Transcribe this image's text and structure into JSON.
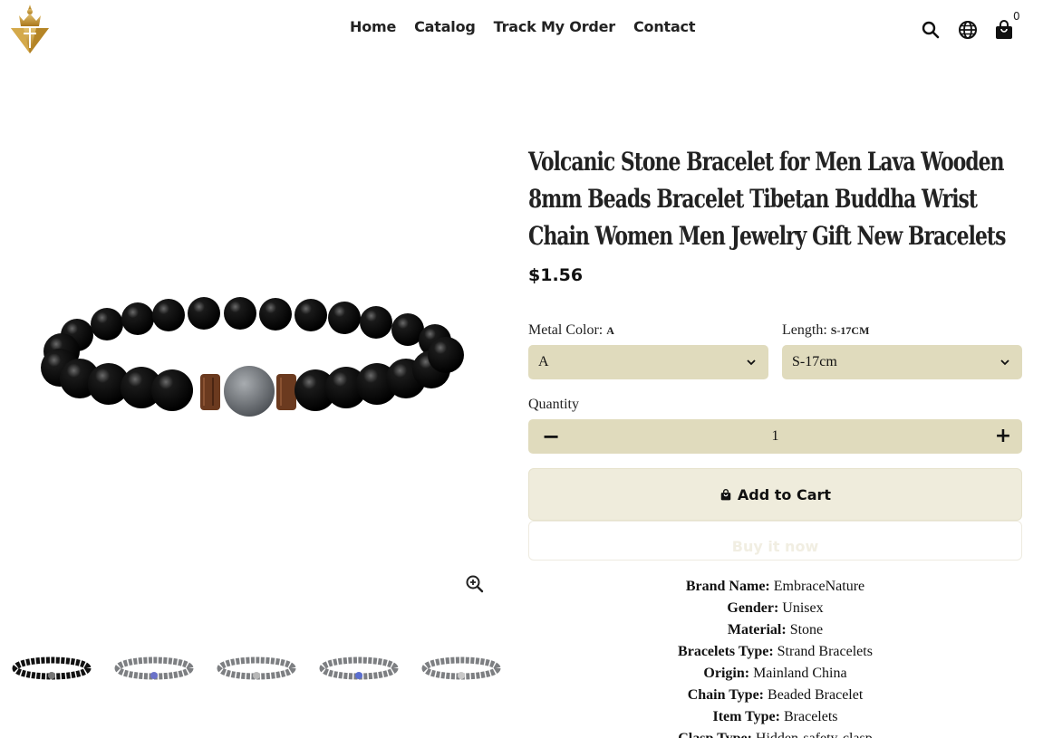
{
  "header": {
    "nav": [
      "Home",
      "Catalog",
      "Track My Order",
      "Contact"
    ],
    "cart_count": "0",
    "icons": [
      "logo-crown-diamond",
      "search-icon",
      "globe-icon",
      "shopping-bag-icon"
    ]
  },
  "product": {
    "title": "Volcanic Stone Bracelet for Men Lava Wooden 8mm Beads Bracelet Tibetan Buddha Wrist Chain Women Men Jewelry Gift New Bracelets",
    "price": "$1.56",
    "options": {
      "metal_color": {
        "label": "Metal Color:",
        "current": "A",
        "selected": "A"
      },
      "length": {
        "label": "Length:",
        "current": "S-17CM",
        "selected": "S-17cm"
      }
    },
    "quantity": {
      "label": "Quantity",
      "value": "1",
      "minus": "−",
      "plus": "+"
    },
    "add_to_cart": "Add to Cart",
    "buy_now": "Buy it now",
    "specs": [
      {
        "key": "Brand Name:",
        "value": "EmbraceNature"
      },
      {
        "key": "Gender:",
        "value": "Unisex"
      },
      {
        "key": "Material:",
        "value": "Stone"
      },
      {
        "key": "Bracelets Type:",
        "value": "Strand Bracelets"
      },
      {
        "key": "Origin:",
        "value": "Mainland China"
      },
      {
        "key": "Chain Type:",
        "value": "Beaded Bracelet"
      },
      {
        "key": "Item Type:",
        "value": "Bracelets"
      },
      {
        "key": "Clasp Type:",
        "value": "Hidden-safety-clasp"
      }
    ]
  },
  "colors": {
    "accent": "#e0dbbd",
    "button_bg": "#efecdc",
    "text": "#222222",
    "logo_gold": "#c99a2e"
  }
}
